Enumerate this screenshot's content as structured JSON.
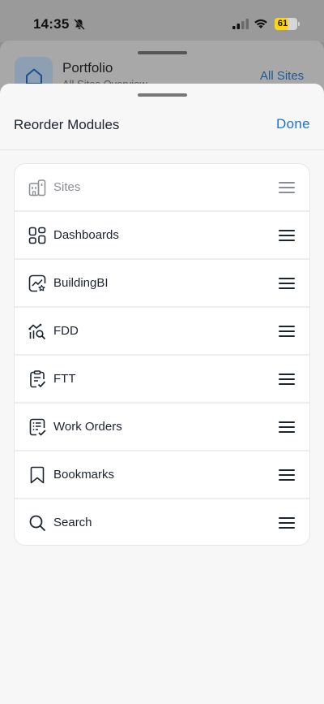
{
  "status_bar": {
    "time": "14:35",
    "battery_level": "61"
  },
  "background": {
    "title": "Portfolio",
    "subtitle": "All Sites Overview",
    "link": "All Sites"
  },
  "sheet": {
    "title": "Reorder Modules",
    "done_label": "Done"
  },
  "modules": [
    {
      "label": "Sites",
      "icon": "building-icon",
      "disabled": true
    },
    {
      "label": "Dashboards",
      "icon": "dashboard-grid-icon",
      "disabled": false
    },
    {
      "label": "BuildingBI",
      "icon": "chart-star-icon",
      "disabled": false
    },
    {
      "label": "FDD",
      "icon": "chart-search-icon",
      "disabled": false
    },
    {
      "label": "FTT",
      "icon": "clipboard-check-icon",
      "disabled": false
    },
    {
      "label": "Work Orders",
      "icon": "work-order-icon",
      "disabled": false
    },
    {
      "label": "Bookmarks",
      "icon": "bookmark-icon",
      "disabled": false
    },
    {
      "label": "Search",
      "icon": "search-icon",
      "disabled": false
    }
  ],
  "colors": {
    "accent": "#1a73c8",
    "text": "#1c2430",
    "disabled_text": "#8a8d92",
    "battery": "#ffd60a"
  }
}
